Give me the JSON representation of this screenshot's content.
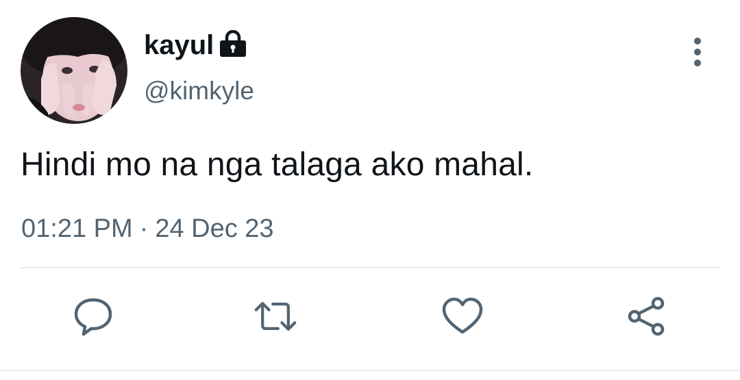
{
  "user": {
    "display_name": "kayul",
    "handle": "@kimkyle",
    "protected_icon": "lock-icon"
  },
  "tweet": {
    "text": "Hindi mo na nga talaga ako mahal.",
    "time": "01:21 PM",
    "separator": "·",
    "date": "24 Dec 23"
  },
  "actions": [
    {
      "name": "reply",
      "icon": "comment-icon"
    },
    {
      "name": "retweet",
      "icon": "retweet-icon"
    },
    {
      "name": "like",
      "icon": "heart-icon"
    },
    {
      "name": "share",
      "icon": "share-icon"
    }
  ],
  "menu_icon": "more-vertical-icon",
  "colors": {
    "primary_text": "#0f1419",
    "secondary_text": "#536471",
    "icon": "#536471",
    "divider": "#e6e9eb"
  }
}
